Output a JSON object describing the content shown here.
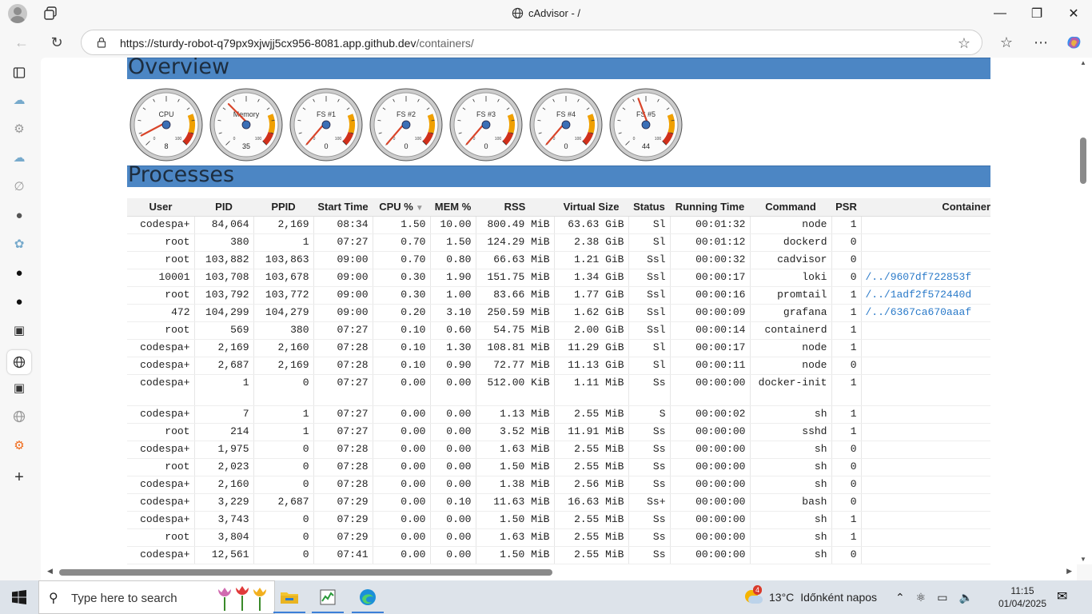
{
  "browser": {
    "tab_title": "cAdvisor - /",
    "url_host": "https://sturdy-robot-q79px9xjwjj5cx956-8081.app.github.dev",
    "url_path": "/containers/"
  },
  "overview": {
    "title": "Overview",
    "gauges": [
      {
        "label": "CPU",
        "value": "8",
        "level": 8
      },
      {
        "label": "Memory",
        "value": "35",
        "level": 35
      },
      {
        "label": "FS #1",
        "value": "0",
        "level": 0
      },
      {
        "label": "FS #2",
        "value": "0",
        "level": 0
      },
      {
        "label": "FS #3",
        "value": "0",
        "level": 0
      },
      {
        "label": "FS #4",
        "value": "0",
        "level": 0
      },
      {
        "label": "FS #5",
        "value": "44",
        "level": 44
      }
    ],
    "gauge_scale_min": "0",
    "gauge_scale_max": "100"
  },
  "processes": {
    "title": "Processes",
    "columns": [
      "User",
      "PID",
      "PPID",
      "Start Time",
      "CPU %",
      "MEM %",
      "RSS",
      "Virtual Size",
      "Status",
      "Running Time",
      "Command",
      "PSR",
      "Container"
    ],
    "rows": [
      [
        "codespa+",
        "84,064",
        "2,169",
        "08:34",
        "1.50",
        "10.00",
        "800.49 MiB",
        "63.63 GiB",
        "Sl",
        "00:01:32",
        "node",
        "1",
        ""
      ],
      [
        "root",
        "380",
        "1",
        "07:27",
        "0.70",
        "1.50",
        "124.29 MiB",
        "2.38 GiB",
        "Sl",
        "00:01:12",
        "dockerd",
        "0",
        ""
      ],
      [
        "root",
        "103,882",
        "103,863",
        "09:00",
        "0.70",
        "0.80",
        "66.63 MiB",
        "1.21 GiB",
        "Ssl",
        "00:00:32",
        "cadvisor",
        "0",
        ""
      ],
      [
        "10001",
        "103,708",
        "103,678",
        "09:00",
        "0.30",
        "1.90",
        "151.75 MiB",
        "1.34 GiB",
        "Ssl",
        "00:00:17",
        "loki",
        "0",
        "/../9607df722853f"
      ],
      [
        "root",
        "103,792",
        "103,772",
        "09:00",
        "0.30",
        "1.00",
        "83.66 MiB",
        "1.77 GiB",
        "Ssl",
        "00:00:16",
        "promtail",
        "1",
        "/../1adf2f572440d"
      ],
      [
        "472",
        "104,299",
        "104,279",
        "09:00",
        "0.20",
        "3.10",
        "250.59 MiB",
        "1.62 GiB",
        "Ssl",
        "00:00:09",
        "grafana",
        "1",
        "/../6367ca670aaaf"
      ],
      [
        "root",
        "569",
        "380",
        "07:27",
        "0.10",
        "0.60",
        "54.75 MiB",
        "2.00 GiB",
        "Ssl",
        "00:00:14",
        "containerd",
        "1",
        ""
      ],
      [
        "codespa+",
        "2,169",
        "2,160",
        "07:28",
        "0.10",
        "1.30",
        "108.81 MiB",
        "11.29 GiB",
        "Sl",
        "00:00:17",
        "node",
        "1",
        ""
      ],
      [
        "codespa+",
        "2,687",
        "2,169",
        "07:28",
        "0.10",
        "0.90",
        "72.77 MiB",
        "11.13 GiB",
        "Sl",
        "00:00:11",
        "node",
        "0",
        ""
      ],
      [
        "codespa+",
        "1",
        "0",
        "07:27",
        "0.00",
        "0.00",
        "512.00 KiB",
        "1.11 MiB",
        "Ss",
        "00:00:00",
        "docker-init",
        "1",
        ""
      ],
      [
        "codespa+",
        "7",
        "1",
        "07:27",
        "0.00",
        "0.00",
        "1.13 MiB",
        "2.55 MiB",
        "S",
        "00:00:02",
        "sh",
        "1",
        ""
      ],
      [
        "root",
        "214",
        "1",
        "07:27",
        "0.00",
        "0.00",
        "3.52 MiB",
        "11.91 MiB",
        "Ss",
        "00:00:00",
        "sshd",
        "1",
        ""
      ],
      [
        "codespa+",
        "1,975",
        "0",
        "07:28",
        "0.00",
        "0.00",
        "1.63 MiB",
        "2.55 MiB",
        "Ss",
        "00:00:00",
        "sh",
        "0",
        ""
      ],
      [
        "root",
        "2,023",
        "0",
        "07:28",
        "0.00",
        "0.00",
        "1.50 MiB",
        "2.55 MiB",
        "Ss",
        "00:00:00",
        "sh",
        "0",
        ""
      ],
      [
        "codespa+",
        "2,160",
        "0",
        "07:28",
        "0.00",
        "0.00",
        "1.38 MiB",
        "2.56 MiB",
        "Ss",
        "00:00:00",
        "sh",
        "0",
        ""
      ],
      [
        "codespa+",
        "3,229",
        "2,687",
        "07:29",
        "0.00",
        "0.10",
        "11.63 MiB",
        "16.63 MiB",
        "Ss+",
        "00:00:00",
        "bash",
        "0",
        ""
      ],
      [
        "codespa+",
        "3,743",
        "0",
        "07:29",
        "0.00",
        "0.00",
        "1.50 MiB",
        "2.55 MiB",
        "Ss",
        "00:00:00",
        "sh",
        "1",
        ""
      ],
      [
        "root",
        "3,804",
        "0",
        "07:29",
        "0.00",
        "0.00",
        "1.63 MiB",
        "2.55 MiB",
        "Ss",
        "00:00:00",
        "sh",
        "1",
        ""
      ],
      [
        "codespa+",
        "12,561",
        "0",
        "07:41",
        "0.00",
        "0.00",
        "1.50 MiB",
        "2.55 MiB",
        "Ss",
        "00:00:00",
        "sh",
        "0",
        ""
      ]
    ]
  },
  "taskbar": {
    "search_placeholder": "Type here to search",
    "weather_temp": "13°C",
    "weather_text": "Időnként napos",
    "weather_badge": "4",
    "time": "11:15",
    "date": "01/04/2025"
  },
  "colors": {
    "section_band": "#4c86c4",
    "link": "#2a7ac9",
    "gauge_needle": "#d9452a",
    "gauge_warning": "#f0a000",
    "gauge_danger": "#d0301b"
  }
}
